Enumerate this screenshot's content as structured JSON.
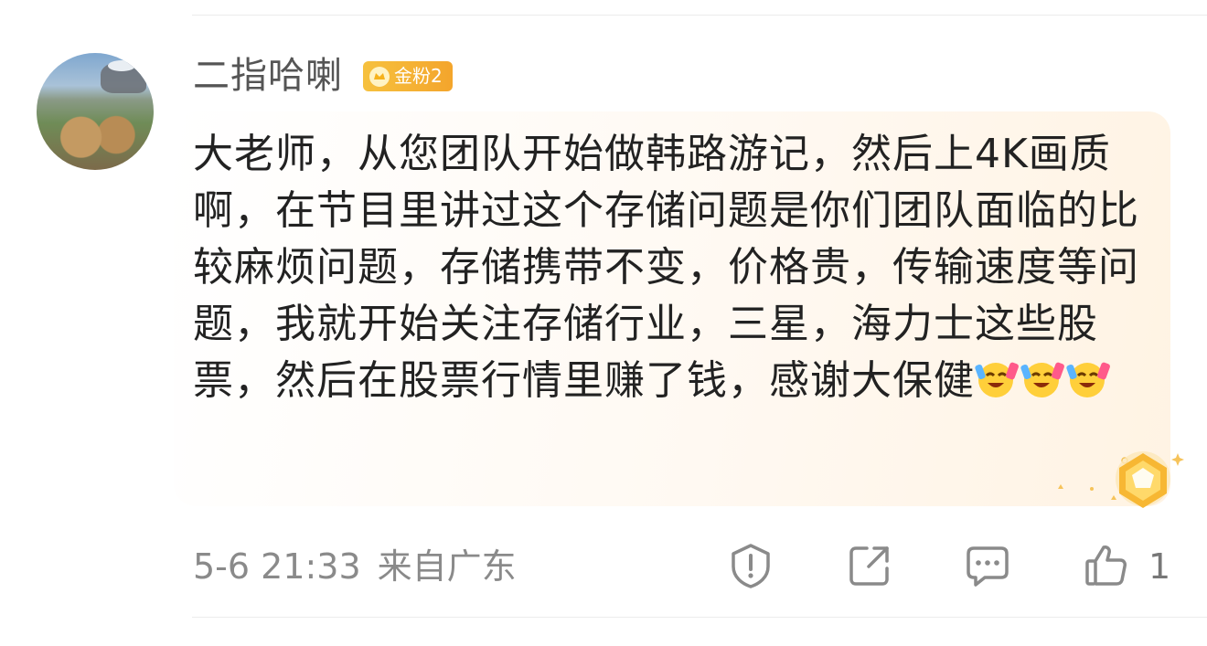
{
  "comment": {
    "username": "二指哈喇",
    "badge": {
      "label": "金粉2",
      "icon": "fan-crown-icon",
      "color": "#f4a52c"
    },
    "text": "大老师，从您团队开始做韩路游记，然后上4K画质啊，在节目里讲过这个存储问题是你们团队面临的比较麻烦问题，存储携带不变，价格贵，传输速度等问题，我就开始关注存储行业，三星，海力士这些股票，然后在股票行情里赚了钱，感谢大保健",
    "emojis": [
      "cheer-emoji",
      "cheer-emoji",
      "cheer-emoji"
    ],
    "timestamp": "5-6 21:33",
    "location": "来自广东",
    "likes": "1"
  },
  "actions": {
    "report_icon": "report-icon",
    "share_icon": "share-icon",
    "reply_icon": "comment-icon",
    "like_icon": "thumbs-up-icon"
  }
}
